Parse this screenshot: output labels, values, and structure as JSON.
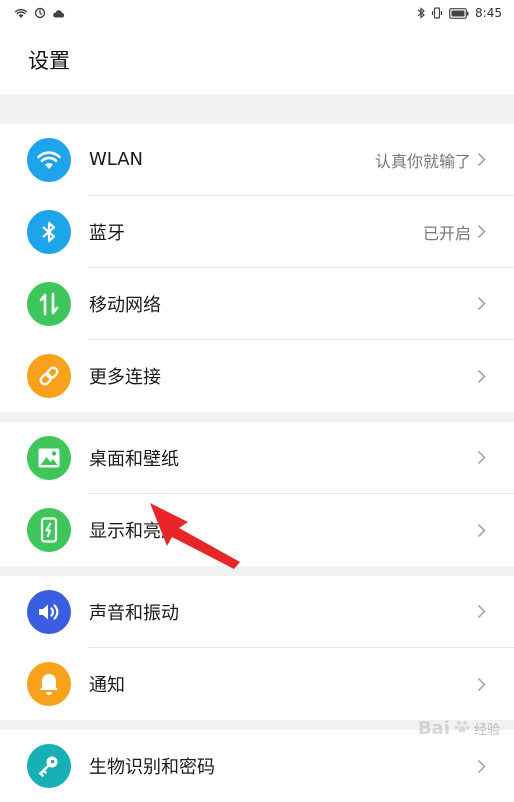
{
  "status_bar": {
    "time": "8:45"
  },
  "header": {
    "title": "设置"
  },
  "groups": [
    {
      "items": [
        {
          "label": "WLAN",
          "value": "认真你就输了",
          "icon": "wifi-icon",
          "color": "#1ea4ea"
        },
        {
          "label": "蓝牙",
          "value": "已开启",
          "icon": "bluetooth-icon",
          "color": "#1ea4ea"
        },
        {
          "label": "移动网络",
          "value": "",
          "icon": "mobile-data-icon",
          "color": "#3ec65b"
        },
        {
          "label": "更多连接",
          "value": "",
          "icon": "link-icon",
          "color": "#f7a21a"
        }
      ]
    },
    {
      "items": [
        {
          "label": "桌面和壁纸",
          "value": "",
          "icon": "wallpaper-icon",
          "color": "#3ec65b"
        },
        {
          "label": "显示和亮度",
          "value": "",
          "icon": "display-brightness-icon",
          "color": "#3ec65b"
        }
      ]
    },
    {
      "items": [
        {
          "label": "声音和振动",
          "value": "",
          "icon": "volume-icon",
          "color": "#3b5ee0"
        },
        {
          "label": "通知",
          "value": "",
          "icon": "bell-icon",
          "color": "#f7a21a"
        }
      ]
    },
    {
      "items": [
        {
          "label": "生物识别和密码",
          "value": "",
          "icon": "key-icon",
          "color": "#16b0b5"
        }
      ]
    }
  ],
  "annotation": {
    "arrow_color": "#e8262a"
  },
  "watermark": {
    "text": "经验",
    "logo": "Bai"
  }
}
